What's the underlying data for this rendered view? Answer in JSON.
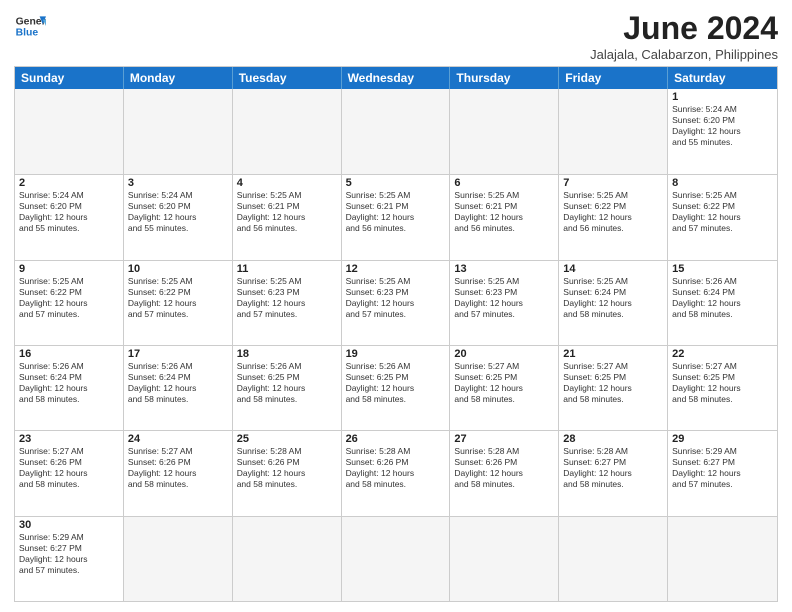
{
  "logo": {
    "line1": "General",
    "line2": "Blue"
  },
  "title": "June 2024",
  "subtitle": "Jalajala, Calabarzon, Philippines",
  "dayHeaders": [
    "Sunday",
    "Monday",
    "Tuesday",
    "Wednesday",
    "Thursday",
    "Friday",
    "Saturday"
  ],
  "weeks": [
    [
      {
        "num": "",
        "info": "",
        "empty": true
      },
      {
        "num": "",
        "info": "",
        "empty": true
      },
      {
        "num": "",
        "info": "",
        "empty": true
      },
      {
        "num": "",
        "info": "",
        "empty": true
      },
      {
        "num": "",
        "info": "",
        "empty": true
      },
      {
        "num": "",
        "info": "",
        "empty": true
      },
      {
        "num": "1",
        "info": "Sunrise: 5:24 AM\nSunset: 6:20 PM\nDaylight: 12 hours\nand 55 minutes.",
        "empty": false
      }
    ],
    [
      {
        "num": "2",
        "info": "Sunrise: 5:24 AM\nSunset: 6:20 PM\nDaylight: 12 hours\nand 55 minutes.",
        "empty": false
      },
      {
        "num": "3",
        "info": "Sunrise: 5:24 AM\nSunset: 6:20 PM\nDaylight: 12 hours\nand 55 minutes.",
        "empty": false
      },
      {
        "num": "4",
        "info": "Sunrise: 5:25 AM\nSunset: 6:21 PM\nDaylight: 12 hours\nand 56 minutes.",
        "empty": false
      },
      {
        "num": "5",
        "info": "Sunrise: 5:25 AM\nSunset: 6:21 PM\nDaylight: 12 hours\nand 56 minutes.",
        "empty": false
      },
      {
        "num": "6",
        "info": "Sunrise: 5:25 AM\nSunset: 6:21 PM\nDaylight: 12 hours\nand 56 minutes.",
        "empty": false
      },
      {
        "num": "7",
        "info": "Sunrise: 5:25 AM\nSunset: 6:22 PM\nDaylight: 12 hours\nand 56 minutes.",
        "empty": false
      },
      {
        "num": "8",
        "info": "Sunrise: 5:25 AM\nSunset: 6:22 PM\nDaylight: 12 hours\nand 57 minutes.",
        "empty": false
      }
    ],
    [
      {
        "num": "9",
        "info": "Sunrise: 5:25 AM\nSunset: 6:22 PM\nDaylight: 12 hours\nand 57 minutes.",
        "empty": false
      },
      {
        "num": "10",
        "info": "Sunrise: 5:25 AM\nSunset: 6:22 PM\nDaylight: 12 hours\nand 57 minutes.",
        "empty": false
      },
      {
        "num": "11",
        "info": "Sunrise: 5:25 AM\nSunset: 6:23 PM\nDaylight: 12 hours\nand 57 minutes.",
        "empty": false
      },
      {
        "num": "12",
        "info": "Sunrise: 5:25 AM\nSunset: 6:23 PM\nDaylight: 12 hours\nand 57 minutes.",
        "empty": false
      },
      {
        "num": "13",
        "info": "Sunrise: 5:25 AM\nSunset: 6:23 PM\nDaylight: 12 hours\nand 57 minutes.",
        "empty": false
      },
      {
        "num": "14",
        "info": "Sunrise: 5:25 AM\nSunset: 6:24 PM\nDaylight: 12 hours\nand 58 minutes.",
        "empty": false
      },
      {
        "num": "15",
        "info": "Sunrise: 5:26 AM\nSunset: 6:24 PM\nDaylight: 12 hours\nand 58 minutes.",
        "empty": false
      }
    ],
    [
      {
        "num": "16",
        "info": "Sunrise: 5:26 AM\nSunset: 6:24 PM\nDaylight: 12 hours\nand 58 minutes.",
        "empty": false
      },
      {
        "num": "17",
        "info": "Sunrise: 5:26 AM\nSunset: 6:24 PM\nDaylight: 12 hours\nand 58 minutes.",
        "empty": false
      },
      {
        "num": "18",
        "info": "Sunrise: 5:26 AM\nSunset: 6:25 PM\nDaylight: 12 hours\nand 58 minutes.",
        "empty": false
      },
      {
        "num": "19",
        "info": "Sunrise: 5:26 AM\nSunset: 6:25 PM\nDaylight: 12 hours\nand 58 minutes.",
        "empty": false
      },
      {
        "num": "20",
        "info": "Sunrise: 5:27 AM\nSunset: 6:25 PM\nDaylight: 12 hours\nand 58 minutes.",
        "empty": false
      },
      {
        "num": "21",
        "info": "Sunrise: 5:27 AM\nSunset: 6:25 PM\nDaylight: 12 hours\nand 58 minutes.",
        "empty": false
      },
      {
        "num": "22",
        "info": "Sunrise: 5:27 AM\nSunset: 6:25 PM\nDaylight: 12 hours\nand 58 minutes.",
        "empty": false
      }
    ],
    [
      {
        "num": "23",
        "info": "Sunrise: 5:27 AM\nSunset: 6:26 PM\nDaylight: 12 hours\nand 58 minutes.",
        "empty": false
      },
      {
        "num": "24",
        "info": "Sunrise: 5:27 AM\nSunset: 6:26 PM\nDaylight: 12 hours\nand 58 minutes.",
        "empty": false
      },
      {
        "num": "25",
        "info": "Sunrise: 5:28 AM\nSunset: 6:26 PM\nDaylight: 12 hours\nand 58 minutes.",
        "empty": false
      },
      {
        "num": "26",
        "info": "Sunrise: 5:28 AM\nSunset: 6:26 PM\nDaylight: 12 hours\nand 58 minutes.",
        "empty": false
      },
      {
        "num": "27",
        "info": "Sunrise: 5:28 AM\nSunset: 6:26 PM\nDaylight: 12 hours\nand 58 minutes.",
        "empty": false
      },
      {
        "num": "28",
        "info": "Sunrise: 5:28 AM\nSunset: 6:27 PM\nDaylight: 12 hours\nand 58 minutes.",
        "empty": false
      },
      {
        "num": "29",
        "info": "Sunrise: 5:29 AM\nSunset: 6:27 PM\nDaylight: 12 hours\nand 57 minutes.",
        "empty": false
      }
    ],
    [
      {
        "num": "30",
        "info": "Sunrise: 5:29 AM\nSunset: 6:27 PM\nDaylight: 12 hours\nand 57 minutes.",
        "empty": false
      },
      {
        "num": "",
        "info": "",
        "empty": true
      },
      {
        "num": "",
        "info": "",
        "empty": true
      },
      {
        "num": "",
        "info": "",
        "empty": true
      },
      {
        "num": "",
        "info": "",
        "empty": true
      },
      {
        "num": "",
        "info": "",
        "empty": true
      },
      {
        "num": "",
        "info": "",
        "empty": true
      }
    ]
  ]
}
